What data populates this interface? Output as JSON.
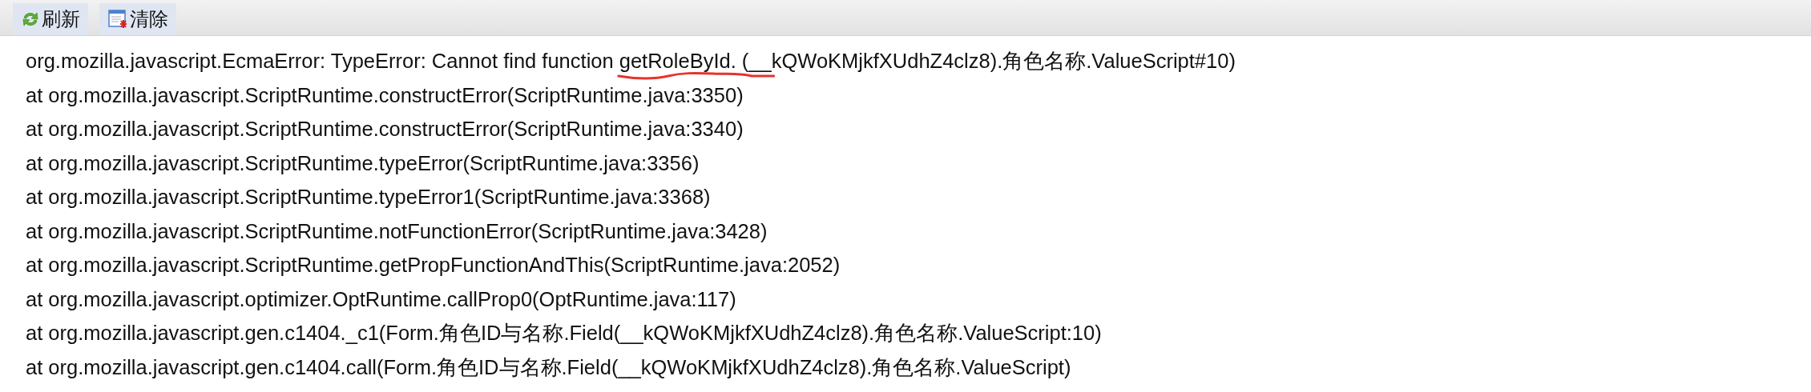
{
  "toolbar": {
    "buttons": [
      {
        "kind": "refresh",
        "label": "刷新"
      },
      {
        "kind": "clear",
        "label": "清除"
      }
    ]
  },
  "log": {
    "lines": [
      {
        "text": "org.mozilla.javascript.EcmaError: TypeError: Cannot find function getRoleById. (__kQWoKMjkfXUdhZ4clz8).角色名称.ValueScript#10)",
        "marked": true
      },
      {
        "text": "at org.mozilla.javascript.ScriptRuntime.constructError(ScriptRuntime.java:3350)",
        "marked": false
      },
      {
        "text": "at org.mozilla.javascript.ScriptRuntime.constructError(ScriptRuntime.java:3340)",
        "marked": false
      },
      {
        "text": "at org.mozilla.javascript.ScriptRuntime.typeError(ScriptRuntime.java:3356)",
        "marked": false
      },
      {
        "text": "at org.mozilla.javascript.ScriptRuntime.typeError1(ScriptRuntime.java:3368)",
        "marked": false
      },
      {
        "text": "at org.mozilla.javascript.ScriptRuntime.notFunctionError(ScriptRuntime.java:3428)",
        "marked": false
      },
      {
        "text": "at org.mozilla.javascript.ScriptRuntime.getPropFunctionAndThis(ScriptRuntime.java:2052)",
        "marked": false
      },
      {
        "text": "at org.mozilla.javascript.optimizer.OptRuntime.callProp0(OptRuntime.java:117)",
        "marked": false
      },
      {
        "text": "at org.mozilla.javascript.gen.c1404._c1(Form.角色ID与名称.Field(__kQWoKMjkfXUdhZ4clz8).角色名称.ValueScript:10)",
        "marked": false
      },
      {
        "text": "at org.mozilla.javascript.gen.c1404.call(Form.角色ID与名称.Field(__kQWoKMjkfXUdhZ4clz8).角色名称.ValueScript)",
        "marked": false
      }
    ]
  }
}
